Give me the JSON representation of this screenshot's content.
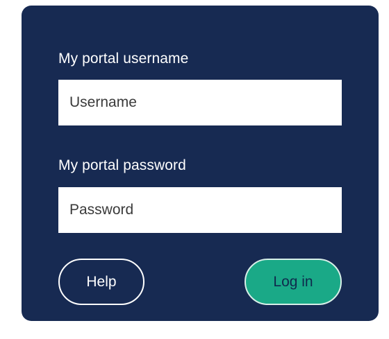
{
  "login": {
    "username_label": "My portal username",
    "username_placeholder": "Username",
    "username_value": "",
    "password_label": "My portal password",
    "password_placeholder": "Password",
    "password_value": "",
    "help_label": "Help",
    "login_label": "Log in"
  },
  "colors": {
    "panel": "#172a52",
    "accent": "#1aa987",
    "field_bg": "#ffffff"
  }
}
